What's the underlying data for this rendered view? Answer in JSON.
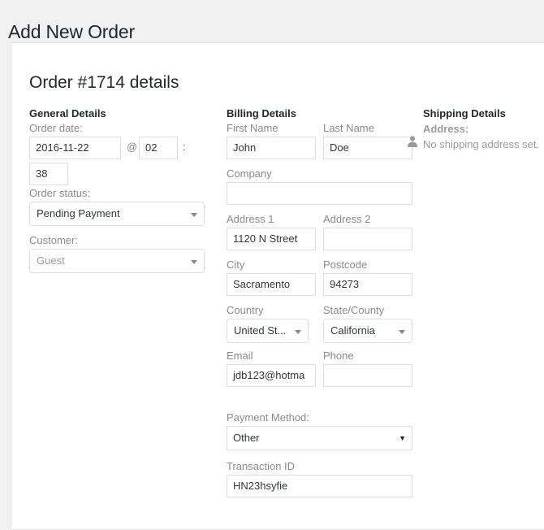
{
  "page": {
    "title": "Add New Order",
    "order_heading": "Order #1714 details"
  },
  "sections": {
    "general": {
      "title": "General Details"
    },
    "billing": {
      "title": "Billing Details",
      "avatar_icon": "person-icon"
    },
    "shipping": {
      "title": "Shipping Details"
    }
  },
  "general": {
    "order_date_label": "Order date:",
    "order_date_value": "2016-11-22",
    "at_symbol": "@",
    "hour_value": "02",
    "colon": ":",
    "minute_value": "38",
    "order_status_label": "Order status:",
    "order_status_value": "Pending Payment",
    "customer_label": "Customer:",
    "customer_placeholder": "Guest"
  },
  "billing": {
    "first_name_label": "First Name",
    "first_name_value": "John",
    "last_name_label": "Last Name",
    "last_name_value": "Doe",
    "company_label": "Company",
    "company_value": "",
    "address1_label": "Address 1",
    "address1_value": "1120 N Street",
    "address2_label": "Address 2",
    "address2_value": "",
    "city_label": "City",
    "city_value": "Sacramento",
    "postcode_label": "Postcode",
    "postcode_value": "94273",
    "country_label": "Country",
    "country_value": "United St...",
    "state_label": "State/County",
    "state_value": "California",
    "email_label": "Email",
    "email_value": "jdb123@hotma",
    "phone_label": "Phone",
    "phone_value": "",
    "payment_method_label": "Payment Method:",
    "payment_method_value": "Other",
    "transaction_id_label": "Transaction ID",
    "transaction_id_value": "HN23hsyfie"
  },
  "shipping": {
    "address_label": "Address:",
    "address_value": "No shipping address set."
  },
  "colors": {
    "page_background": "#f1f1f1",
    "panel_background": "#ffffff",
    "border": "#dddddd",
    "label_text": "#8a8a8a",
    "value_text": "#32373c",
    "heading_text": "#23282d",
    "muted_text": "#9b9b9b"
  }
}
